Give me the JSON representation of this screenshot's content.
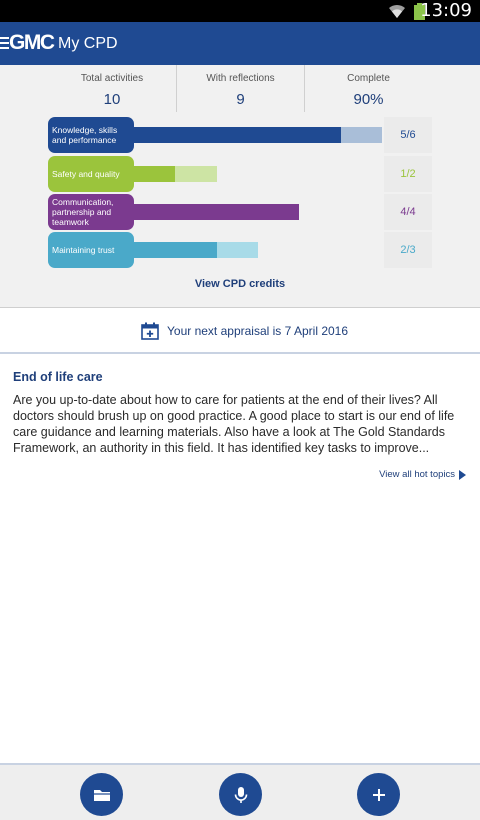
{
  "status_bar": {
    "time": "13:09",
    "wifi_icon": "wifi-icon",
    "battery_icon": "battery-icon",
    "battery_color": "#8bc34a"
  },
  "app_bar": {
    "logo": "GMC",
    "title": "My CPD",
    "menu_icon": "menu-icon",
    "color": "#1f4a92"
  },
  "summary": {
    "total_label": "Total activities",
    "total_value": "10",
    "reflections_label": "With reflections",
    "reflections_value": "9",
    "complete_label": "Complete",
    "complete_value": "90%"
  },
  "categories": [
    {
      "label": "Knowledge, skills and performance",
      "count": "5/6",
      "done": 5,
      "total": 6,
      "color": "#1f4a92",
      "track": "#a9bed8"
    },
    {
      "label": "Safety and quality",
      "count": "1/2",
      "done": 1,
      "total": 2,
      "color": "#9bc43c",
      "track": "#cde4a4"
    },
    {
      "label": "Communication, partnership and teamwork",
      "count": "4/4",
      "done": 4,
      "total": 4,
      "color": "#7b3a8f",
      "track": "#c9a8d3"
    },
    {
      "label": "Maintaining trust",
      "count": "2/3",
      "done": 2,
      "total": 3,
      "color": "#4aa9c9",
      "track": "#a8dbe8"
    }
  ],
  "view_credits": "View CPD credits",
  "appraisal": {
    "text": "Your next appraisal is 7 April 2016",
    "icon": "calendar-icon"
  },
  "hot_topic": {
    "title": "End of life care",
    "body": "Are you up-to-date about how to care for patients at the end of their lives? All doctors should brush up on good practice. A good place to start is our end of life care guidance and learning materials. Also have a look at The Gold Standards Framework, an authority in this field. It has identified key tasks to improve...",
    "link": "View all hot topics"
  },
  "bottom_actions": [
    {
      "icon": "folder-icon"
    },
    {
      "icon": "microphone-icon"
    },
    {
      "icon": "plus-icon"
    }
  ]
}
